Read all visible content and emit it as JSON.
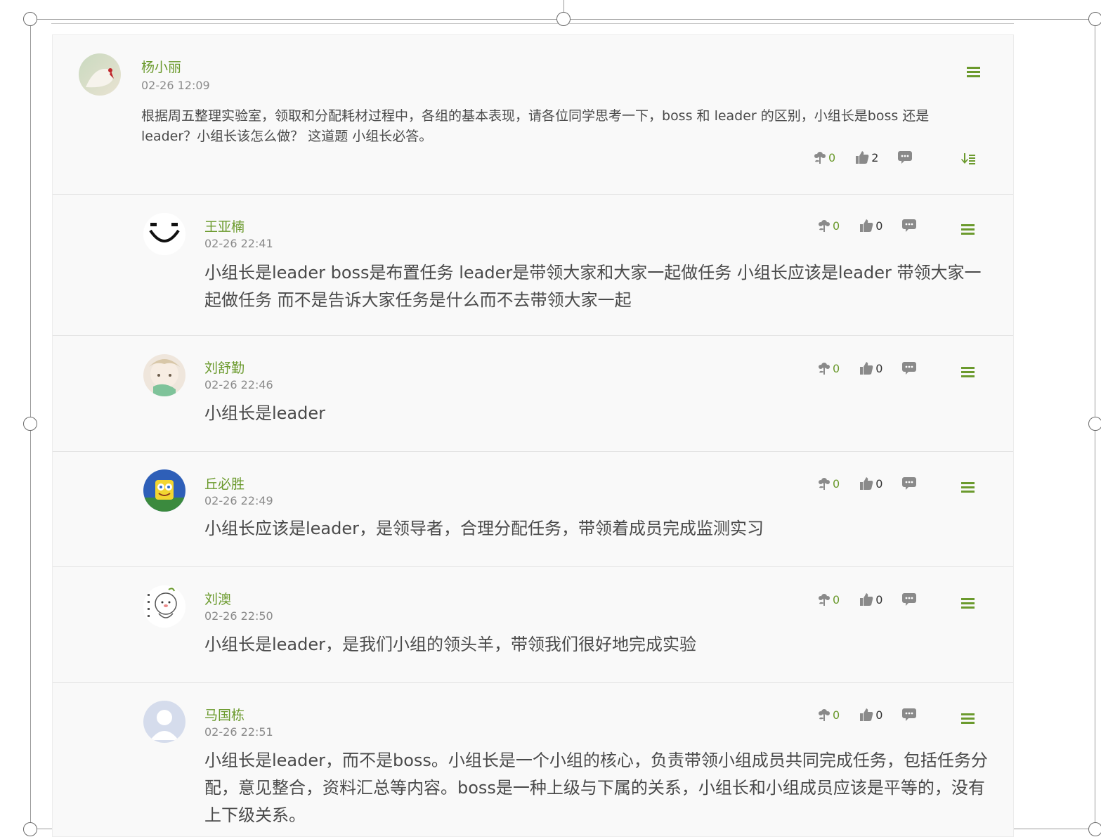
{
  "post": {
    "author": "杨小丽",
    "time": "02-26 12:09",
    "body": "根据周五整理实验室，领取和分配耗材过程中，各组的基本表现，请各位同学思考一下，boss 和 leader 的区别，小组长是boss 还是leader？小组长该怎么做？ 这道题 小组长必答。",
    "flowers": "0",
    "likes": "2"
  },
  "replies": [
    {
      "author": "王亚楠",
      "time": "02-26 22:41",
      "body": "小组长是leader boss是布置任务 leader是带领大家和大家一起做任务 小组长应该是leader 带领大家一起做任务 而不是告诉大家任务是什么而不去带领大家一起",
      "flowers": "0",
      "likes": "0"
    },
    {
      "author": "刘舒勤",
      "time": "02-26 22:46",
      "body": "小组长是leader",
      "flowers": "0",
      "likes": "0"
    },
    {
      "author": "丘必胜",
      "time": "02-26 22:49",
      "body": "小组长应该是leader，是领导者，合理分配任务，带领着成员完成监测实习",
      "flowers": "0",
      "likes": "0"
    },
    {
      "author": "刘澳",
      "time": "02-26 22:50",
      "body": "小组长是leader，是我们小组的领头羊，带领我们很好地完成实验",
      "flowers": "0",
      "likes": "0"
    },
    {
      "author": "马国栋",
      "time": "02-26 22:51",
      "body": "小组长是leader，而不是boss。小组长是一个小组的核心，负责带领小组成员共同完成任务，包括任务分配，意见整合，资料汇总等内容。boss是一种上级与下属的关系，小组长和小组成员应该是平等的，没有上下级关系。",
      "flowers": "0",
      "likes": "0"
    }
  ],
  "icons": {
    "flower": "flower-icon",
    "like": "thumbs-up-icon",
    "comment": "comment-icon",
    "menu": "menu-icon",
    "sort": "sort-down-icon"
  },
  "colors": {
    "accent_green": "#6b9a2d",
    "icon_gray": "#8a8a8a",
    "panel_bg": "#f9f9f9"
  }
}
